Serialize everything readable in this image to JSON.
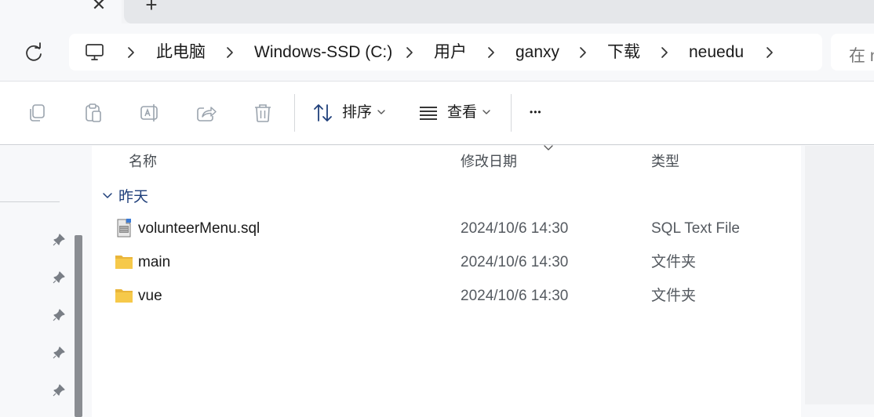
{
  "tabs": {
    "close_glyph": "✕",
    "add_glyph": "+"
  },
  "breadcrumb": [
    {
      "label": "此电脑"
    },
    {
      "label": "Windows-SSD (C:)"
    },
    {
      "label": "用户"
    },
    {
      "label": "ganxy"
    },
    {
      "label": "下载"
    },
    {
      "label": "neuedu"
    }
  ],
  "search": {
    "placeholder": "在 n"
  },
  "toolbar": {
    "sort_label": "排序",
    "view_label": "查看",
    "more_glyph": "•••"
  },
  "columns": {
    "name": "名称",
    "modified": "修改日期",
    "type": "类型"
  },
  "group": {
    "label": "昨天"
  },
  "files": [
    {
      "name": "volunteerMenu.sql",
      "modified": "2024/10/6 14:30",
      "type": "SQL Text File",
      "icon": "sql-file-icon"
    },
    {
      "name": "main",
      "modified": "2024/10/6 14:30",
      "type": "文件夹",
      "icon": "folder-icon"
    },
    {
      "name": "vue",
      "modified": "2024/10/6 14:30",
      "type": "文件夹",
      "icon": "folder-icon"
    }
  ],
  "colors": {
    "accent": "#1f3f7a",
    "folder": "#f6c94a",
    "toolbar_disabled": "#9aa3ad"
  }
}
